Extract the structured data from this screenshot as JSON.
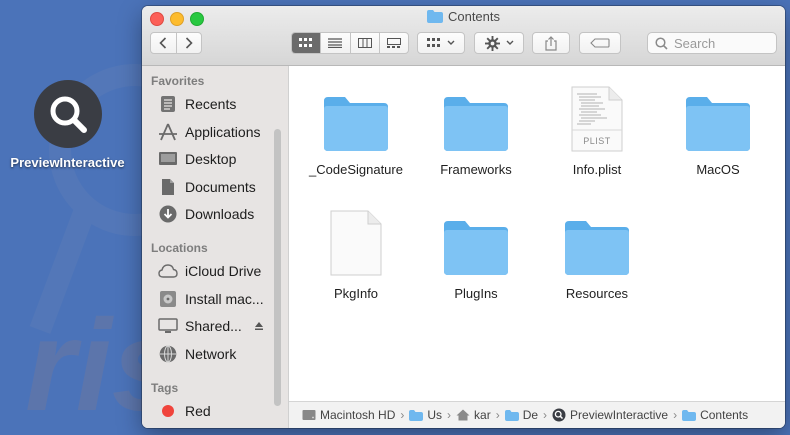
{
  "desktop": {
    "icon_name": "magnifier-icon",
    "label": "PreviewInteractive"
  },
  "window": {
    "title": "Contents"
  },
  "toolbar": {
    "back_icon": "chevron-left-icon",
    "forward_icon": "chevron-right-icon",
    "search_placeholder": "Search"
  },
  "sidebar": {
    "favorites_header": "Favorites",
    "favorites": [
      {
        "label": "Recents",
        "icon": "clock-icon"
      },
      {
        "label": "Applications",
        "icon": "applications-icon"
      },
      {
        "label": "Desktop",
        "icon": "desktop-icon"
      },
      {
        "label": "Documents",
        "icon": "document-icon"
      },
      {
        "label": "Downloads",
        "icon": "download-icon"
      }
    ],
    "locations_header": "Locations",
    "locations": [
      {
        "label": "iCloud Drive",
        "icon": "cloud-icon"
      },
      {
        "label": "Install mac...",
        "icon": "disk-icon"
      },
      {
        "label": "Shared...",
        "icon": "monitor-icon"
      },
      {
        "label": "Network",
        "icon": "network-icon"
      }
    ],
    "tags_header": "Tags",
    "tags": [
      {
        "label": "Red",
        "color": "#f0443c"
      }
    ]
  },
  "files": [
    {
      "name": "_CodeSignature",
      "kind": "folder"
    },
    {
      "name": "Frameworks",
      "kind": "folder"
    },
    {
      "name": "Info.plist",
      "kind": "plist",
      "badge": "PLIST"
    },
    {
      "name": "MacOS",
      "kind": "folder"
    },
    {
      "name": "PkgInfo",
      "kind": "document"
    },
    {
      "name": "PlugIns",
      "kind": "folder"
    },
    {
      "name": "Resources",
      "kind": "folder"
    }
  ],
  "path_bar": [
    {
      "label": "Macintosh HD",
      "icon": "hard-drive-icon"
    },
    {
      "label": "Us",
      "icon": "folder-icon"
    },
    {
      "label": "kar",
      "icon": "home-icon"
    },
    {
      "label": "De",
      "icon": "folder-icon"
    },
    {
      "label": "PreviewInteractive",
      "icon": "app-icon"
    },
    {
      "label": "Contents",
      "icon": "folder-icon"
    }
  ],
  "colors": {
    "folder": "#7ec3f4",
    "folder_dark": "#5aaeea",
    "desktop_bg": "#4b73b9"
  }
}
